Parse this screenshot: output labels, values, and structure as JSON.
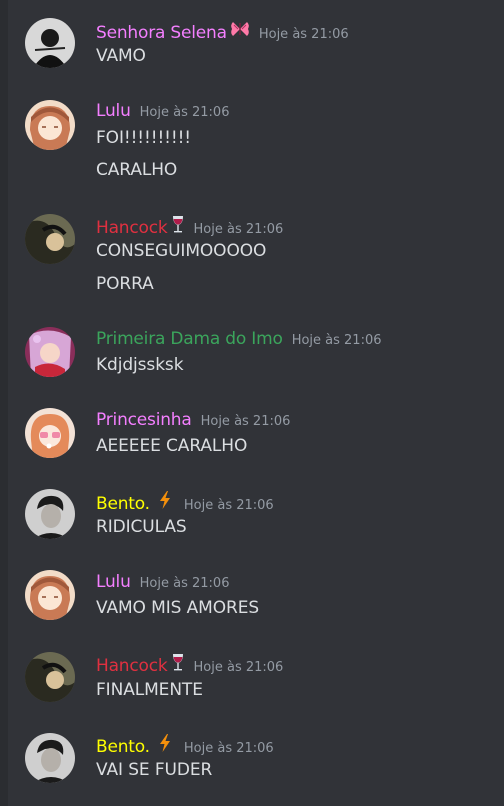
{
  "messages": [
    {
      "author": "Senhora Selena",
      "author_color": "#f47fff",
      "badge": "butterfly-icon",
      "timestamp": "Hoje às 21:06",
      "lines": [
        "VAMO"
      ]
    },
    {
      "author": "Lulu",
      "author_color": "#f47fff",
      "badge": "",
      "timestamp": "Hoje às 21:06",
      "lines": [
        "FOI!!!!!!!!!!",
        "CARALHO"
      ]
    },
    {
      "author": "Hancock",
      "author_color": "#e03040",
      "badge": "wine-glass-icon",
      "timestamp": "Hoje às 21:06",
      "lines": [
        "CONSEGUIMOOOOO",
        "PORRA"
      ]
    },
    {
      "author": "Primeira Dama do Imo",
      "author_color": "#3ba55c",
      "badge": "",
      "timestamp": "Hoje às 21:06",
      "lines": [
        "Kdjdjssksk"
      ]
    },
    {
      "author": "Princesinha",
      "author_color": "#f47fff",
      "badge": "",
      "timestamp": "Hoje às 21:06",
      "lines": [
        "AEEEEE CARALHO"
      ]
    },
    {
      "author": "Bento.",
      "author_color": "#ffff00",
      "badge": "lightning-icon",
      "timestamp": "Hoje às 21:06",
      "lines": [
        "RIDICULAS"
      ]
    },
    {
      "author": "Lulu",
      "author_color": "#f47fff",
      "badge": "",
      "timestamp": "Hoje às 21:06",
      "lines": [
        "VAMO MIS AMORES"
      ]
    },
    {
      "author": "Hancock",
      "author_color": "#e03040",
      "badge": "wine-glass-icon",
      "timestamp": "Hoje às 21:06",
      "lines": [
        "FINALMENTE"
      ]
    },
    {
      "author": "Bento.",
      "author_color": "#ffff00",
      "badge": "lightning-icon",
      "timestamp": "Hoje às 21:06",
      "lines": [
        "VAI SE FUDER"
      ]
    }
  ]
}
